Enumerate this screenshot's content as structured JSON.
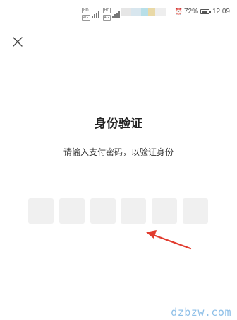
{
  "status_bar": {
    "sim_tags": [
      "HD",
      "4G"
    ],
    "battery_percent": "72%",
    "time": "12:09",
    "blur_colors": [
      "#e6e6e6",
      "#d8e6ee",
      "#b8dfe8",
      "#e9d9a7",
      "#eeeeee"
    ]
  },
  "header": {
    "close_icon": "close-icon"
  },
  "verify": {
    "title": "身份验证",
    "subtitle": "请输入支付密码，以验证身份",
    "pin_length": 6,
    "pin_entered": 0
  },
  "annotation": {
    "arrow_color": "#e23b2e"
  },
  "watermark": {
    "text": "dzbzw.com"
  }
}
